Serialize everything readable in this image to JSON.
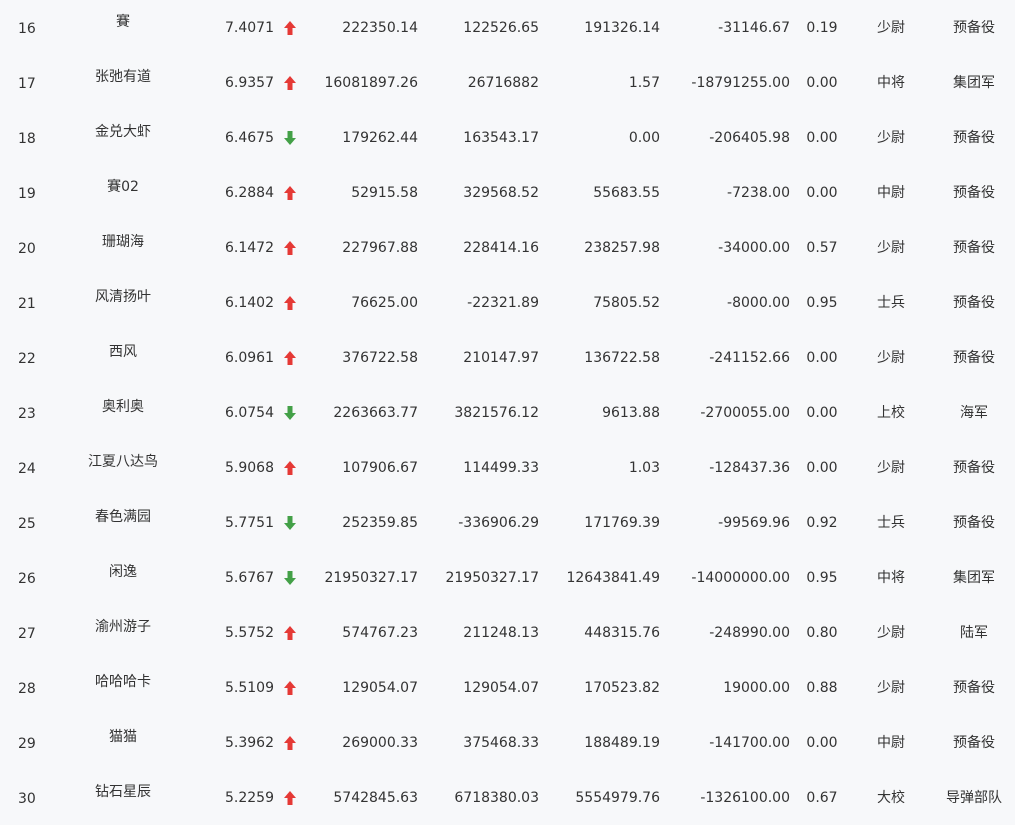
{
  "colors": {
    "up": "#e53935",
    "down": "#43a047",
    "text": "#333333",
    "background": "#f7f8fa"
  },
  "rows": [
    {
      "rank": "16",
      "name": "賽",
      "score": "7.4071",
      "trend": "up",
      "v1": "222350.14",
      "v2": "122526.65",
      "v3": "191326.14",
      "v4": "-31146.67",
      "ratio": "0.19",
      "title": "少尉",
      "unit": "预备役"
    },
    {
      "rank": "17",
      "name": "张弛有道",
      "score": "6.9357",
      "trend": "up",
      "v1": "16081897.26",
      "v2": "26716882",
      "v3": "1.57",
      "v4": "-18791255.00",
      "ratio": "0.00",
      "title": "中将",
      "unit": "集团军"
    },
    {
      "rank": "18",
      "name": "金兑大虾",
      "score": "6.4675",
      "trend": "down",
      "v1": "179262.44",
      "v2": "163543.17",
      "v3": "0.00",
      "v4": "-206405.98",
      "ratio": "0.00",
      "title": "少尉",
      "unit": "预备役"
    },
    {
      "rank": "19",
      "name": "賽02",
      "score": "6.2884",
      "trend": "up",
      "v1": "52915.58",
      "v2": "329568.52",
      "v3": "55683.55",
      "v4": "-7238.00",
      "ratio": "0.00",
      "title": "中尉",
      "unit": "预备役"
    },
    {
      "rank": "20",
      "name": "珊瑚海",
      "score": "6.1472",
      "trend": "up",
      "v1": "227967.88",
      "v2": "228414.16",
      "v3": "238257.98",
      "v4": "-34000.00",
      "ratio": "0.57",
      "title": "少尉",
      "unit": "预备役"
    },
    {
      "rank": "21",
      "name": "风清扬叶",
      "score": "6.1402",
      "trend": "up",
      "v1": "76625.00",
      "v2": "-22321.89",
      "v3": "75805.52",
      "v4": "-8000.00",
      "ratio": "0.95",
      "title": "士兵",
      "unit": "预备役"
    },
    {
      "rank": "22",
      "name": "西风",
      "score": "6.0961",
      "trend": "up",
      "v1": "376722.58",
      "v2": "210147.97",
      "v3": "136722.58",
      "v4": "-241152.66",
      "ratio": "0.00",
      "title": "少尉",
      "unit": "预备役"
    },
    {
      "rank": "23",
      "name": "奥利奥",
      "score": "6.0754",
      "trend": "down",
      "v1": "2263663.77",
      "v2": "3821576.12",
      "v3": "9613.88",
      "v4": "-2700055.00",
      "ratio": "0.00",
      "title": "上校",
      "unit": "海军"
    },
    {
      "rank": "24",
      "name": "江夏八达鸟",
      "score": "5.9068",
      "trend": "up",
      "v1": "107906.67",
      "v2": "114499.33",
      "v3": "1.03",
      "v4": "-128437.36",
      "ratio": "0.00",
      "title": "少尉",
      "unit": "预备役"
    },
    {
      "rank": "25",
      "name": "春色满园",
      "score": "5.7751",
      "trend": "down",
      "v1": "252359.85",
      "v2": "-336906.29",
      "v3": "171769.39",
      "v4": "-99569.96",
      "ratio": "0.92",
      "title": "士兵",
      "unit": "预备役"
    },
    {
      "rank": "26",
      "name": "闲逸",
      "score": "5.6767",
      "trend": "down",
      "v1": "21950327.17",
      "v2": "21950327.17",
      "v3": "12643841.49",
      "v4": "-14000000.00",
      "ratio": "0.95",
      "title": "中将",
      "unit": "集团军"
    },
    {
      "rank": "27",
      "name": "渝州游子",
      "score": "5.5752",
      "trend": "up",
      "v1": "574767.23",
      "v2": "211248.13",
      "v3": "448315.76",
      "v4": "-248990.00",
      "ratio": "0.80",
      "title": "少尉",
      "unit": "陆军"
    },
    {
      "rank": "28",
      "name": "哈哈哈卡",
      "score": "5.5109",
      "trend": "up",
      "v1": "129054.07",
      "v2": "129054.07",
      "v3": "170523.82",
      "v4": "19000.00",
      "ratio": "0.88",
      "title": "少尉",
      "unit": "预备役"
    },
    {
      "rank": "29",
      "name": "猫猫",
      "score": "5.3962",
      "trend": "up",
      "v1": "269000.33",
      "v2": "375468.33",
      "v3": "188489.19",
      "v4": "-141700.00",
      "ratio": "0.00",
      "title": "中尉",
      "unit": "预备役"
    },
    {
      "rank": "30",
      "name": "钻石星辰",
      "score": "5.2259",
      "trend": "up",
      "v1": "5742845.63",
      "v2": "6718380.03",
      "v3": "5554979.76",
      "v4": "-1326100.00",
      "ratio": "0.67",
      "title": "大校",
      "unit": "导弹部队"
    }
  ]
}
